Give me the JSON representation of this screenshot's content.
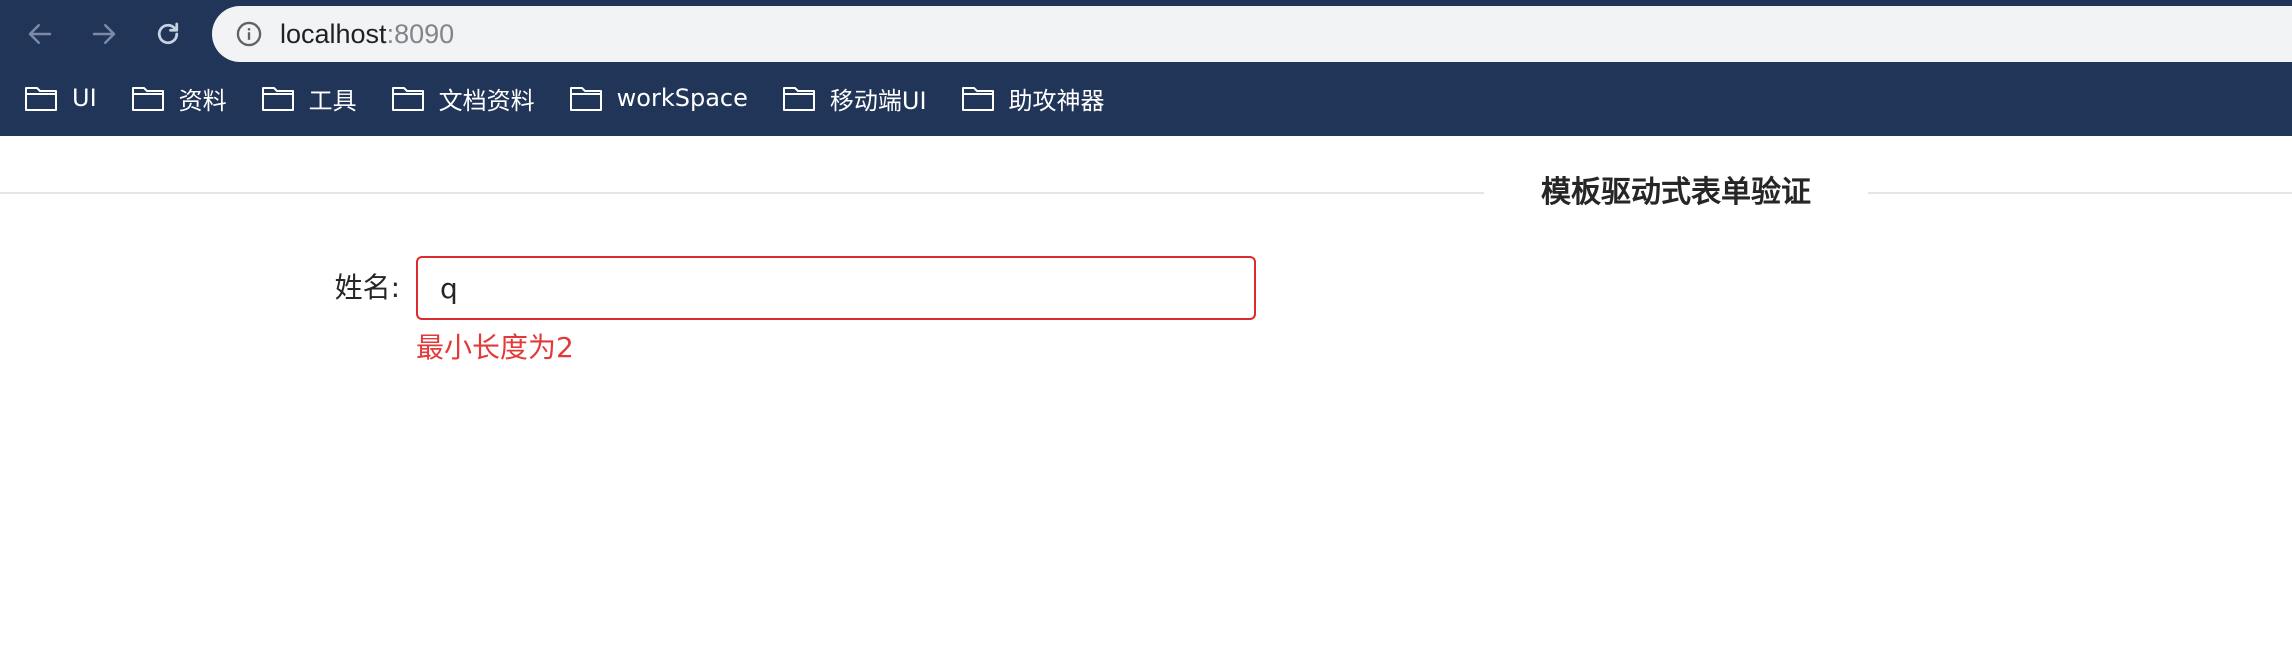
{
  "browser": {
    "url_host": "localhost",
    "url_port": ":8090",
    "bookmarks": [
      {
        "label": "UI"
      },
      {
        "label": "资料"
      },
      {
        "label": "工具"
      },
      {
        "label": "文档资料"
      },
      {
        "label": "workSpace"
      },
      {
        "label": "移动端UI"
      },
      {
        "label": "助攻神器"
      }
    ],
    "colors": {
      "chrome": "#213558",
      "address_bar": "#f1f3f4"
    }
  },
  "page": {
    "title": "模板驱动式表单验证",
    "form": {
      "name_label": "姓名:",
      "name_value": "q",
      "error_message": "最小长度为2"
    },
    "colors": {
      "error": "#e23a3a"
    }
  }
}
